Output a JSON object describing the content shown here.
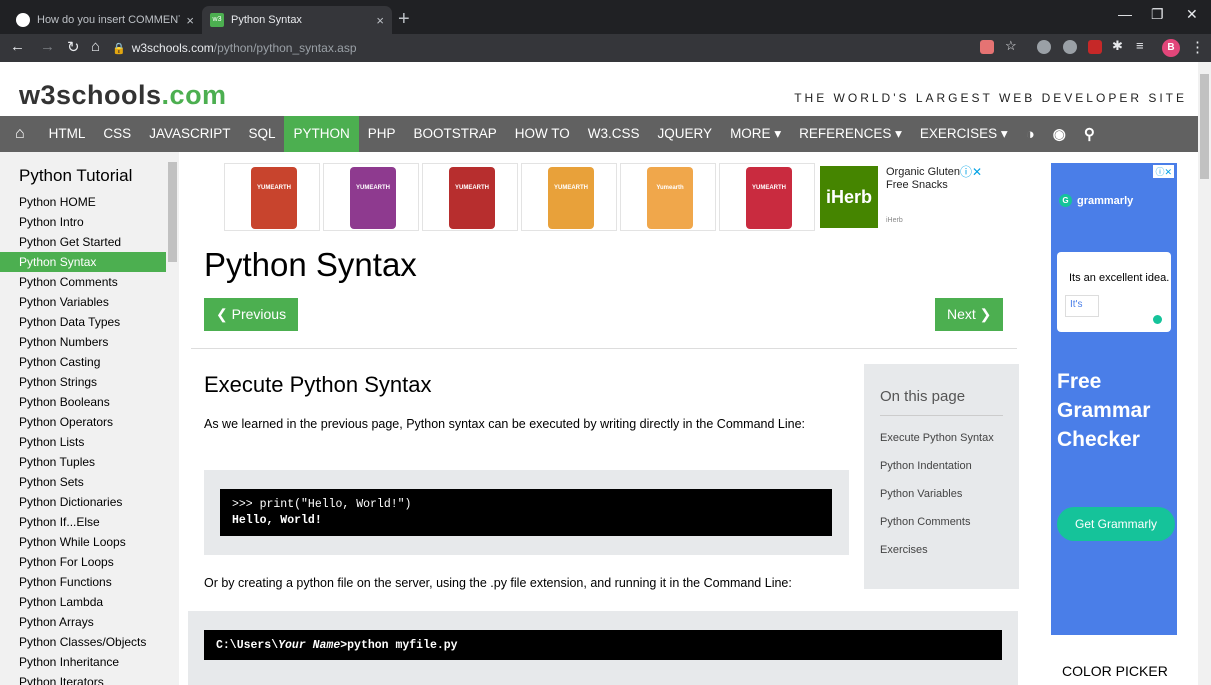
{
  "browser": {
    "tabs": [
      {
        "title": "How do you insert COMMENTS i",
        "close": "×"
      },
      {
        "title": "Python Syntax",
        "close": "×",
        "favicon_text": "w3"
      }
    ],
    "new_tab": "+",
    "url_host": "w3schools.com",
    "url_path": "/python/python_syntax.asp",
    "profile_initial": "B",
    "window_controls": [
      "—",
      "❐",
      "✕"
    ]
  },
  "site": {
    "logo_main": "w3schools",
    "logo_suffix": ".com",
    "tagline": "THE WORLD'S LARGEST WEB DEVELOPER SITE"
  },
  "topnav": {
    "items": [
      "HTML",
      "CSS",
      "JAVASCRIPT",
      "SQL",
      "PYTHON",
      "PHP",
      "BOOTSTRAP",
      "HOW TO",
      "W3.CSS",
      "JQUERY",
      "MORE ▾",
      "REFERENCES ▾",
      "EXERCISES ▾"
    ],
    "active": "PYTHON"
  },
  "sidebar": {
    "heading": "Python Tutorial",
    "items": [
      "Python HOME",
      "Python Intro",
      "Python Get Started",
      "Python Syntax",
      "Python Comments",
      "Python Variables",
      "Python Data Types",
      "Python Numbers",
      "Python Casting",
      "Python Strings",
      "Python Booleans",
      "Python Operators",
      "Python Lists",
      "Python Tuples",
      "Python Sets",
      "Python Dictionaries",
      "Python If...Else",
      "Python While Loops",
      "Python For Loops",
      "Python Functions",
      "Python Lambda",
      "Python Arrays",
      "Python Classes/Objects",
      "Python Inheritance",
      "Python Iterators"
    ],
    "selected": "Python Syntax"
  },
  "ad_top": {
    "products": [
      "YUMEARTH",
      "YUMEARTH",
      "YUMEARTH",
      "YUMEARTH",
      "Yumearth",
      "YUMEARTH"
    ],
    "product_colors": [
      "#c8442d",
      "#8e3a8f",
      "#b72e2e",
      "#e8a13a",
      "#f0a74b",
      "#c92b3f"
    ],
    "logo": "iHerb",
    "text": "Organic Gluten Free Snacks",
    "source": "iHerb"
  },
  "main": {
    "title": "Python Syntax",
    "prev": "❮ Previous",
    "next": "Next ❯",
    "section_title": "Execute Python Syntax",
    "para1": "As we learned in the previous page, Python syntax can be executed by writing directly in the Command Line:",
    "code1_line1": ">>> print(\"Hello, World!\")",
    "code1_line2": "Hello, World!",
    "para2": "Or by creating a python file on the server, using the .py file extension, and running it in the Command Line:",
    "code2_prefix": "C:\\Users\\",
    "code2_italic": "Your Name",
    "code2_suffix": ">python myfile.py"
  },
  "on_this_page": {
    "heading": "On this page",
    "links": [
      "Execute Python Syntax",
      "Python Indentation",
      "Python Variables",
      "Python Comments",
      "Exercises"
    ]
  },
  "ad_side": {
    "brand": "grammarly",
    "sample_text": "Its an excellent idea.",
    "suggestion": "It's",
    "headline_1": "Free",
    "headline_2": "Grammar",
    "headline_3": "Checker",
    "cta": "Get Grammarly",
    "close": "ⓘ✕"
  },
  "color_picker": "COLOR PICKER"
}
